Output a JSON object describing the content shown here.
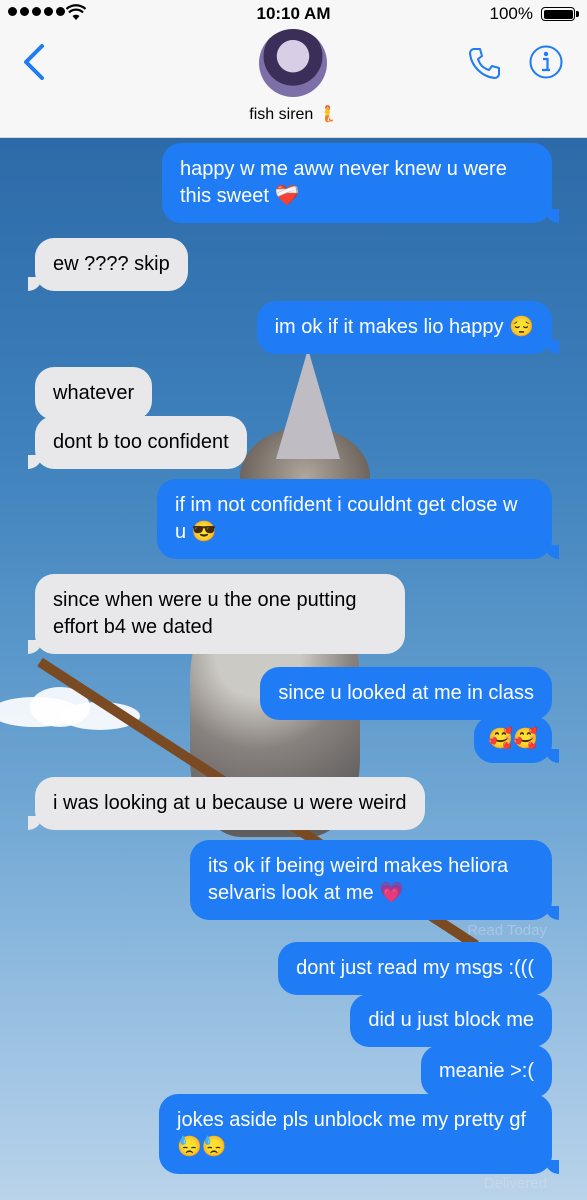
{
  "status_bar": {
    "time": "10:10 AM",
    "battery": "100%"
  },
  "header": {
    "contact_name": "fish siren 🧜",
    "back_icon": "chevron-left-icon",
    "phone_icon": "phone-icon",
    "info_icon": "info-icon"
  },
  "colors": {
    "sent_bubble": "#1f7cf4",
    "received_bubble": "#e8e8ea",
    "accent": "#1f7cf4"
  },
  "messages": [
    {
      "from": "me",
      "text": "happy w me aww never knew u were this sweet ❤️‍🩹"
    },
    {
      "from": "them",
      "text": "ew ???? skip"
    },
    {
      "from": "me",
      "text": "im ok if it makes lio happy 😔"
    },
    {
      "from": "them",
      "text": "whatever"
    },
    {
      "from": "them",
      "text": "dont b too confident"
    },
    {
      "from": "me",
      "text": "if im not confident i couldnt get close w u 😎"
    },
    {
      "from": "them",
      "text": "since when were u the one putting effort b4 we dated"
    },
    {
      "from": "me",
      "text": "since u looked at me in class"
    },
    {
      "from": "me",
      "text": "🥰🥰"
    },
    {
      "from": "them",
      "text": "i was looking at u because u were weird"
    },
    {
      "from": "me",
      "text": "its ok if being weird makes heliora selvaris look at me 💗"
    },
    {
      "from": "me",
      "text": "dont just read my msgs :((("
    },
    {
      "from": "me",
      "text": "did u just block me"
    },
    {
      "from": "me",
      "text": "meanie >:("
    },
    {
      "from": "me",
      "text": "jokes aside pls unblock me my pretty gf 😓😓"
    }
  ],
  "read_receipt": "Read Today",
  "delivered_label": "Delivered"
}
